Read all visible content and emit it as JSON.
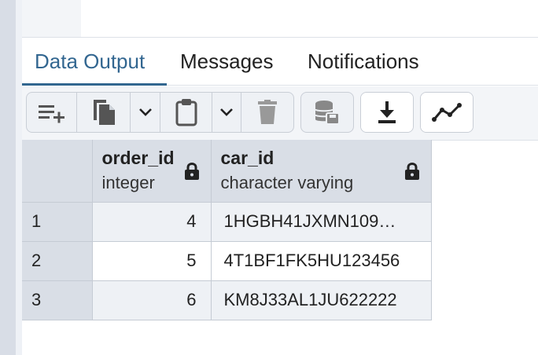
{
  "tabs": [
    {
      "label": "Data Output",
      "active": true
    },
    {
      "label": "Messages",
      "active": false
    },
    {
      "label": "Notifications",
      "active": false
    }
  ],
  "toolbar": {
    "icons": [
      "add-row-icon",
      "copy-icon",
      "chevron-down-icon",
      "paste-icon",
      "chevron-down-icon",
      "delete-icon",
      "save-data-icon",
      "download-icon",
      "graph-visualiser-icon"
    ]
  },
  "grid": {
    "columns": [
      {
        "name": "order_id",
        "type": "integer"
      },
      {
        "name": "car_id",
        "type": "character varying"
      }
    ],
    "rows": [
      {
        "row": "1",
        "order_id": "4",
        "car_id": "1HGBH41JXMN109…"
      },
      {
        "row": "2",
        "order_id": "5",
        "car_id": "4T1BF1FK5HU123456"
      },
      {
        "row": "3",
        "order_id": "6",
        "car_id": "KM8J33AL1JU622222"
      }
    ]
  },
  "colors": {
    "accent": "#326690",
    "header_bg": "#d9dee6",
    "toolbar_bg": "#f3f5f8"
  }
}
